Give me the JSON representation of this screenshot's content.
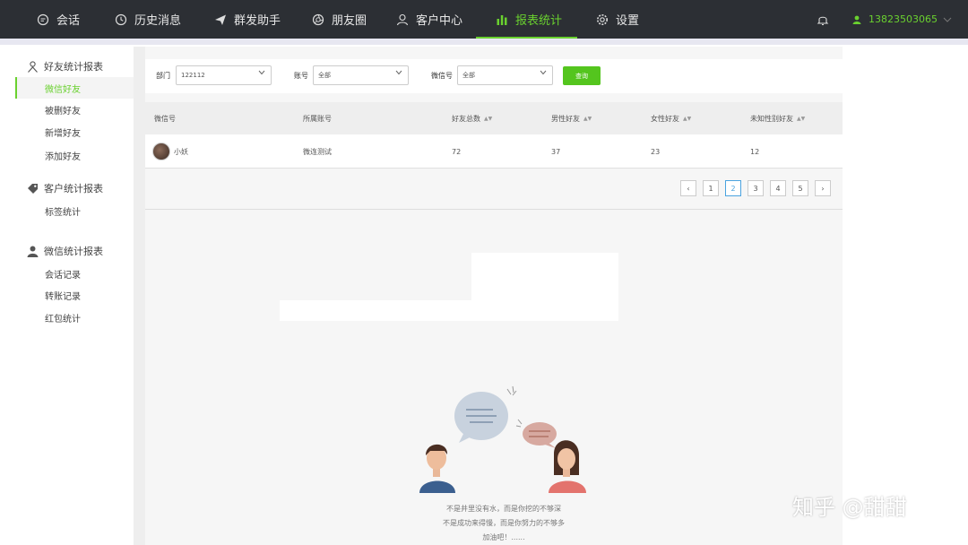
{
  "nav": {
    "items": [
      {
        "label": "会话",
        "icon": "chat-icon"
      },
      {
        "label": "历史消息",
        "icon": "clock-icon"
      },
      {
        "label": "群发助手",
        "icon": "send-icon"
      },
      {
        "label": "朋友圈",
        "icon": "aperture-icon"
      },
      {
        "label": "客户中心",
        "icon": "user-icon"
      },
      {
        "label": "报表统计",
        "icon": "bar-chart-icon",
        "active": true
      },
      {
        "label": "设置",
        "icon": "gear-icon"
      }
    ],
    "phone": "13823503065",
    "accent_color": "#6ad12f"
  },
  "sidebar": {
    "groups": [
      {
        "title": "好友统计报表",
        "icon": "person-icon",
        "items": [
          "微信好友",
          "被删好友",
          "新增好友",
          "添加好友"
        ],
        "active": "微信好友"
      },
      {
        "title": "客户统计报表",
        "icon": "tag-icon",
        "items": [
          "标签统计"
        ]
      },
      {
        "title": "微信统计报表",
        "icon": "person-solid-icon",
        "items": [
          "会话记录",
          "转账记录",
          "红包统计"
        ]
      }
    ]
  },
  "filter": {
    "dept_label": "部门",
    "dept_value": "122112",
    "account_label": "账号",
    "account_value": "全部",
    "wechat_label": "微信号",
    "wechat_value": "全部",
    "query_label": "查询"
  },
  "table": {
    "columns": [
      "微信号",
      "所属账号",
      "好友总数",
      "男性好友",
      "女性好友",
      "未知性别好友"
    ],
    "rows": [
      {
        "wechat": "小妖",
        "account": "微连测试",
        "total": "72",
        "male": "37",
        "female": "23",
        "unknown": "12"
      }
    ]
  },
  "pagination": {
    "prev": "‹",
    "pages": [
      "1",
      "2",
      "3",
      "4",
      "5"
    ],
    "current": "2",
    "next": "›"
  },
  "empty": {
    "line1": "不是井里没有水，而是你挖的不够深",
    "line2": "不是成功来得慢，而是你努力的不够多",
    "line3": "加油吧！......"
  },
  "watermark": "知乎 @甜甜"
}
